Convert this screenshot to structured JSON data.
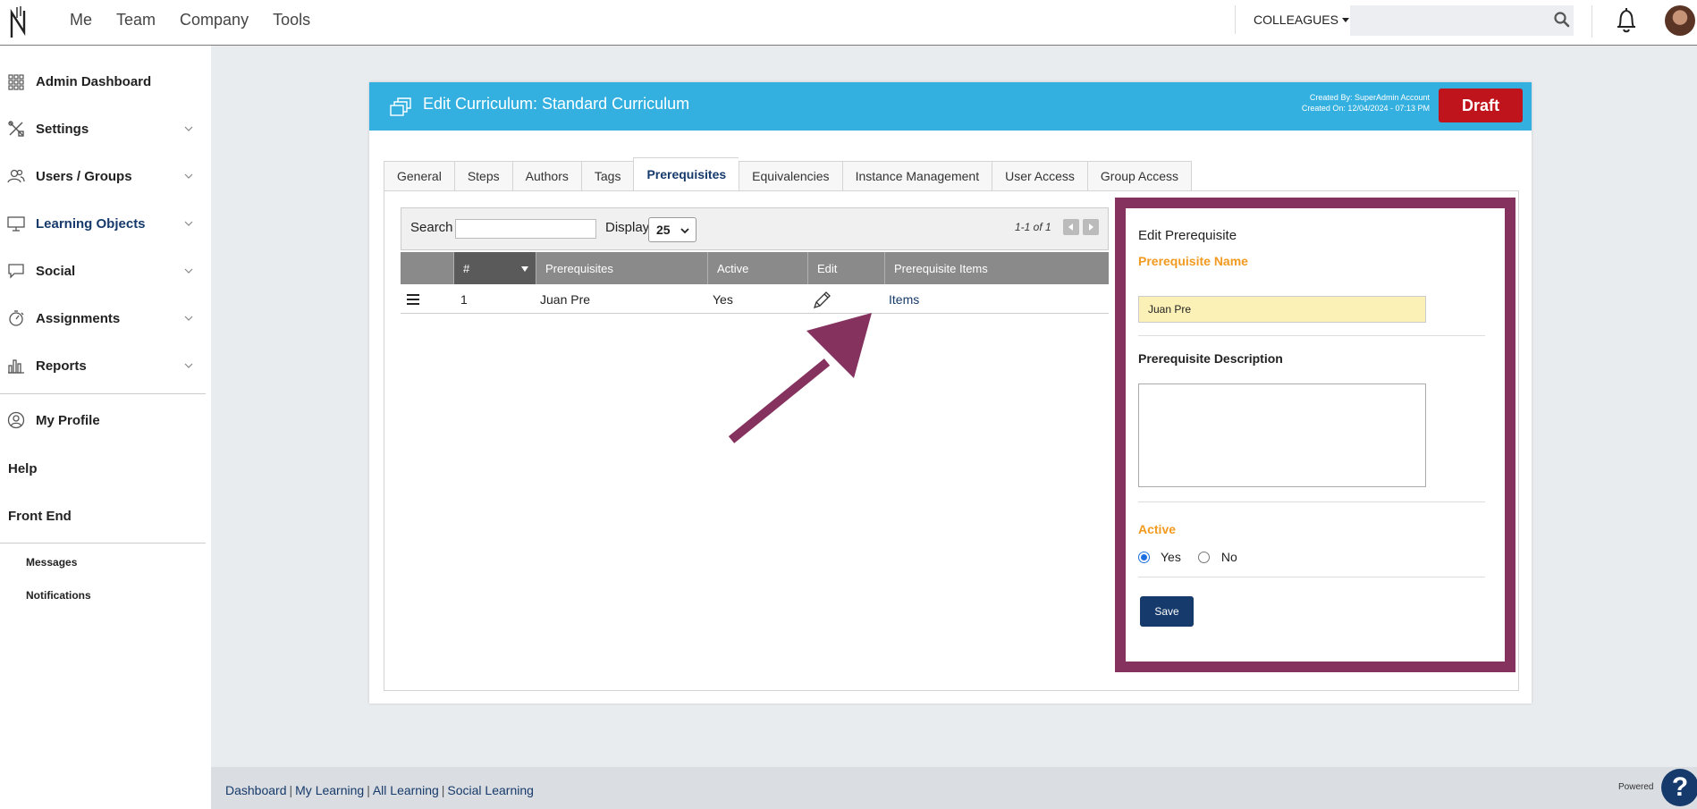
{
  "topnav": {
    "items": [
      "Me",
      "Team",
      "Company",
      "Tools"
    ]
  },
  "topbar": {
    "colleagues_label": "COLLEAGUES",
    "search_placeholder": ""
  },
  "sidebar": {
    "items": [
      {
        "label": "Admin Dashboard",
        "icon": "grid-icon"
      },
      {
        "label": "Settings",
        "icon": "tools-icon"
      },
      {
        "label": "Users / Groups",
        "icon": "users-icon"
      },
      {
        "label": "Learning Objects",
        "icon": "monitor-icon"
      },
      {
        "label": "Social",
        "icon": "chat-icon"
      },
      {
        "label": "Assignments",
        "icon": "stopwatch-icon"
      },
      {
        "label": "Reports",
        "icon": "bar-chart-icon"
      }
    ],
    "profile": "My Profile",
    "help": "Help",
    "front_end": "Front End",
    "messages": "Messages",
    "notifications": "Notifications"
  },
  "header": {
    "title": "Edit Curriculum: Standard Curriculum",
    "created_by": "Created By: SuperAdmin Account",
    "created_on": "Created On: 12/04/2024 - 07:13 PM",
    "draft_label": "Draft",
    "accent_color": "#33b0e0",
    "draft_color": "#c0141c"
  },
  "tabs": [
    "General",
    "Steps",
    "Authors",
    "Tags",
    "Prerequisites",
    "Equivalencies",
    "Instance Management",
    "User Access",
    "Group Access"
  ],
  "table": {
    "search_label": "Search",
    "search_value": "",
    "display_label": "Display",
    "display_value": "25",
    "pager_text": "1-1 of 1",
    "columns": [
      "#",
      "Prerequisites",
      "Active",
      "Edit",
      "Prerequisite Items"
    ],
    "rows": [
      {
        "num": "1",
        "name": "Juan Pre",
        "active": "Yes",
        "items": "Items"
      }
    ]
  },
  "edit_panel": {
    "title": "Edit Prerequisite",
    "name_label": "Prerequisite Name",
    "name_value": "Juan Pre",
    "description_label": "Prerequisite Description",
    "description_value": "",
    "active_label": "Active",
    "yes_label": "Yes",
    "no_label": "No",
    "save_label": "Save",
    "highlight_color": "#85325f"
  },
  "footer": {
    "links": [
      "Dashboard",
      "My Learning",
      "All Learning",
      "Social Learning"
    ],
    "powered": "Powered"
  }
}
